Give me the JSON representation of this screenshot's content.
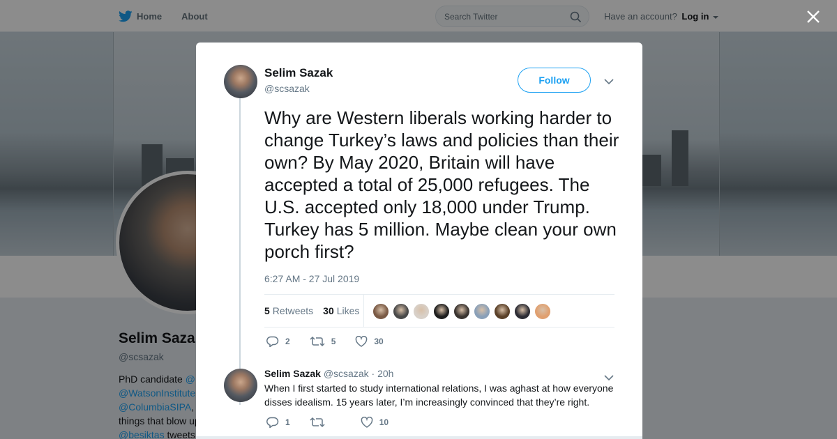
{
  "topbar": {
    "home_label": "Home",
    "about_label": "About",
    "search_placeholder": "Search Twitter",
    "account_prompt": "Have an account?",
    "login_label": "Log in"
  },
  "profile": {
    "name": "Selim Sazak",
    "handle": "@scsazak",
    "bio_line1_prefix": "PhD candidate ",
    "bio_line1_link": "@",
    "bio_line2_link": "@WatsonInstitute",
    "bio_line3_link": "@ColumbiaSIPA",
    "bio_line3_suffix": ",",
    "bio_line4": "things that blow up",
    "bio_line5_link": "@besiktas",
    "bio_line5_suffix": " tweets"
  },
  "tweet": {
    "author_name": "Selim Sazak",
    "author_handle": "@scsazak",
    "follow_label": "Follow",
    "text": "Why are Western liberals working harder to change Turkey’s laws and policies than their own? By May 2020, Britain will have accepted a total of 25,000 refugees. The U.S. accepted only 18,000 under Trump. Turkey has 5 million. Maybe clean your own porch first?",
    "timestamp": "6:27 AM - 27 Jul 2019",
    "retweets_count": "5",
    "retweets_label": "Retweets",
    "likes_count": "30",
    "likes_label": "Likes",
    "reply_count": "2",
    "retweet_count": "5",
    "like_count": "30",
    "liker_colors": [
      "#7a5a45",
      "#4a4a4a",
      "#d8d0c8",
      "#1e1e1e",
      "#3a3430",
      "#8aa0b8",
      "#5a4028",
      "#2c2c34",
      "#e0a070"
    ]
  },
  "reply": {
    "author_name": "Selim Sazak",
    "author_handle": "@scsazak",
    "time_separator": "·",
    "time": "20h",
    "text": "When I first started to study international relations, I was aghast at how everyone disses idealism. 15 years later, I’m increasingly convinced that they’re right.",
    "reply_count": "1",
    "retweet_count": "",
    "like_count": "10"
  },
  "colors": {
    "brand": "#1da1f2",
    "text": "#14171a",
    "secondary": "#657786"
  }
}
